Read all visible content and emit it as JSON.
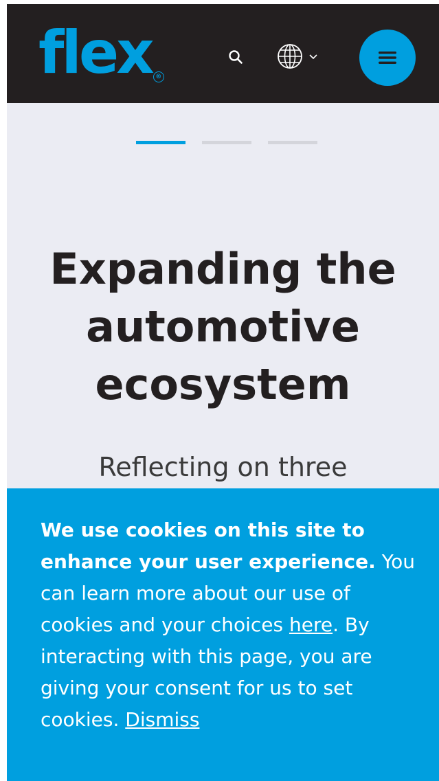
{
  "header": {
    "logo_text": "flex",
    "logo_reg": "®",
    "search_icon": "search-icon",
    "globe_icon": "globe-icon",
    "menu_icon": "hamburger-menu-icon"
  },
  "carousel": {
    "slide_count": 3,
    "active_index": 0
  },
  "hero": {
    "title_lines": [
      "Expanding the",
      "automotive",
      "ecosystem"
    ],
    "subtitle": "Reflecting on three"
  },
  "cookie_banner": {
    "heading": "We use cookies on this site to enhance your user experience.",
    "text_before_link": " You can learn more about our use of cookies and your choices ",
    "link_label": "here",
    "text_after_link": ". By interacting with this page, you are giving your consent for us to set cookies. ",
    "dismiss_label": "Dismiss"
  },
  "colors": {
    "brand_blue": "#009fdf",
    "header_bg": "#231f20",
    "page_bg": "#ebecf3"
  }
}
